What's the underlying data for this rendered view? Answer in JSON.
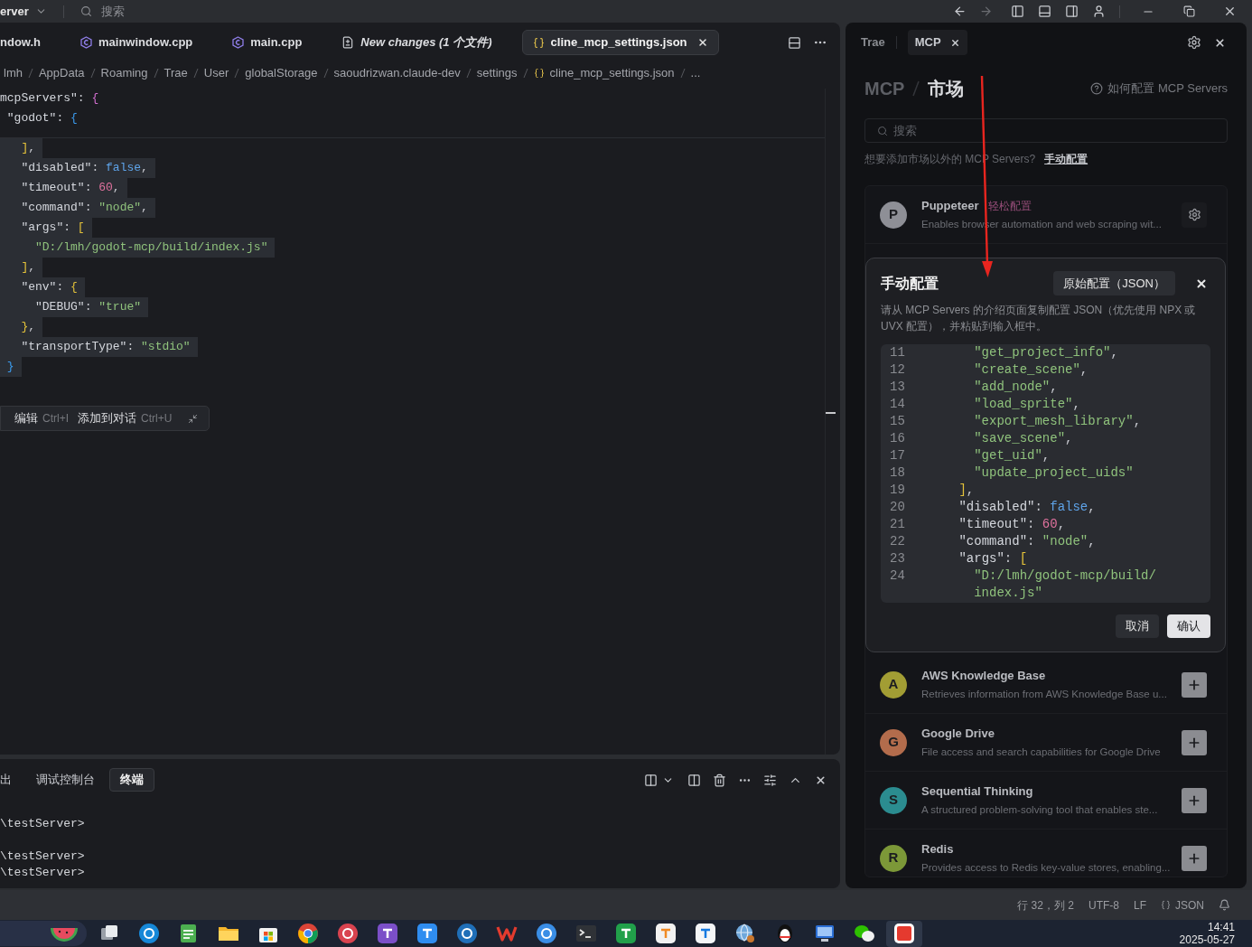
{
  "title_bar": {
    "project": "erver",
    "search": {
      "placeholder": "搜索"
    }
  },
  "editor": {
    "tabs": [
      {
        "label": "ndow.h",
        "kind": "plain",
        "selected": false
      },
      {
        "label": "mainwindow.cpp",
        "kind": "cpp",
        "selected": false
      },
      {
        "label": "main.cpp",
        "kind": "cpp",
        "selected": false
      },
      {
        "label": "New changes (1 个文件)",
        "kind": "diff",
        "selected": false
      },
      {
        "label": "cline_mcp_settings.json",
        "kind": "json",
        "selected": true
      }
    ],
    "breadcrumb": [
      {
        "label": "lmh",
        "kind": "folder"
      },
      {
        "label": "AppData",
        "kind": "folder"
      },
      {
        "label": "Roaming",
        "kind": "folder"
      },
      {
        "label": "Trae",
        "kind": "folder"
      },
      {
        "label": "User",
        "kind": "folder"
      },
      {
        "label": "globalStorage",
        "kind": "folder"
      },
      {
        "label": "saoudrizwan.claude-dev",
        "kind": "folder"
      },
      {
        "label": "settings",
        "kind": "folder"
      },
      {
        "label": "cline_mcp_settings.json",
        "kind": "file"
      },
      {
        "label": "...",
        "kind": "more"
      }
    ],
    "sticky_lines": [
      {
        "tokens": [
          {
            "kind": "key",
            "text": "mcpServers\""
          },
          {
            "kind": "punct",
            "text": ": "
          },
          {
            "kind": "brace1",
            "text": "{"
          }
        ]
      },
      {
        "tokens": [
          {
            "kind": "key",
            "text": " \"godot\""
          },
          {
            "kind": "punct",
            "text": ": "
          },
          {
            "kind": "brace2",
            "text": "{"
          }
        ]
      }
    ],
    "lines": [
      {
        "tokens": [
          {
            "kind": "brace3",
            "text": "   ]"
          },
          {
            "kind": "punct",
            "text": ","
          }
        ]
      },
      {
        "tokens": [
          {
            "kind": "key",
            "text": "   \"disabled\""
          },
          {
            "kind": "punct",
            "text": ": "
          },
          {
            "kind": "bool",
            "text": "false"
          },
          {
            "kind": "punct",
            "text": ","
          }
        ]
      },
      {
        "tokens": [
          {
            "kind": "key",
            "text": "   \"timeout\""
          },
          {
            "kind": "punct",
            "text": ": "
          },
          {
            "kind": "num",
            "text": "60"
          },
          {
            "kind": "punct",
            "text": ","
          }
        ]
      },
      {
        "tokens": [
          {
            "kind": "key",
            "text": "   \"command\""
          },
          {
            "kind": "punct",
            "text": ": "
          },
          {
            "kind": "str",
            "text": "\"node\""
          },
          {
            "kind": "punct",
            "text": ","
          }
        ]
      },
      {
        "tokens": [
          {
            "kind": "key",
            "text": "   \"args\""
          },
          {
            "kind": "punct",
            "text": ": "
          },
          {
            "kind": "brace3",
            "text": "["
          }
        ]
      },
      {
        "tokens": [
          {
            "kind": "str",
            "text": "     \"D:/lmh/godot-mcp/build/index.js\""
          }
        ]
      },
      {
        "tokens": [
          {
            "kind": "brace3",
            "text": "   ]"
          },
          {
            "kind": "punct",
            "text": ","
          }
        ]
      },
      {
        "tokens": [
          {
            "kind": "key",
            "text": "   \"env\""
          },
          {
            "kind": "punct",
            "text": ": "
          },
          {
            "kind": "brace3",
            "text": "{"
          }
        ]
      },
      {
        "tokens": [
          {
            "kind": "key",
            "text": "     \"DEBUG\""
          },
          {
            "kind": "punct",
            "text": ": "
          },
          {
            "kind": "str",
            "text": "\"true\""
          }
        ]
      },
      {
        "tokens": [
          {
            "kind": "brace3",
            "text": "   }"
          },
          {
            "kind": "punct",
            "text": ","
          }
        ]
      },
      {
        "tokens": [
          {
            "kind": "key",
            "text": "   \"transportType\""
          },
          {
            "kind": "punct",
            "text": ": "
          },
          {
            "kind": "str",
            "text": "\"stdio\""
          }
        ]
      },
      {
        "tokens": [
          {
            "kind": "brace2",
            "text": " }"
          }
        ]
      }
    ],
    "inline_actions": [
      {
        "label": "编辑",
        "shortcut": "Ctrl+I"
      },
      {
        "label": "添加到对话",
        "shortcut": "Ctrl+U"
      }
    ]
  },
  "panel": {
    "tabs": [
      {
        "label": "出",
        "selected": false
      },
      {
        "label": "调试控制台",
        "selected": false
      },
      {
        "label": "终端",
        "selected": true
      }
    ],
    "terminal_blocks": [
      [
        "\\testServer>"
      ],
      [
        "\\testServer>",
        "\\testServer>"
      ]
    ]
  },
  "sidebar": {
    "tabs": [
      {
        "label": "Trae",
        "selected": false
      },
      {
        "label": "MCP",
        "selected": true
      }
    ],
    "heading": {
      "root": "MCP",
      "current": "市场"
    },
    "help_link": "如何配置 MCP Servers",
    "search": {
      "placeholder": "搜索"
    },
    "hint": "想要添加市场以外的 MCP Servers?",
    "hint_link": "手动配置",
    "servers": [
      {
        "avatar": "P",
        "color": "#8e8f96",
        "name": "Puppeteer",
        "tag": "轻松配置",
        "description": "Enables browser automation and web scraping wit...",
        "kind": "configured"
      },
      {
        "avatar": "A",
        "color": "#a29d34",
        "name": "AWS Knowledge Base",
        "description": "Retrieves information from AWS Knowledge Base u...",
        "kind": "available"
      },
      {
        "avatar": "G",
        "color": "#b36c4c",
        "name": "Google Drive",
        "description": "File access and search capabilities for Google Drive",
        "kind": "available"
      },
      {
        "avatar": "S",
        "color": "#2b8c90",
        "name": "Sequential Thinking",
        "description": "A structured problem-solving tool that enables ste...",
        "kind": "available"
      },
      {
        "avatar": "R",
        "color": "#7c9838",
        "name": "Redis",
        "description": "Provides access to Redis key-value stores, enabling...",
        "kind": "available"
      }
    ],
    "dialog": {
      "title": "手动配置",
      "mode_button": "原始配置（JSON）",
      "description": "请从 MCP Servers 的介绍页面复制配置 JSON（优先使用 NPX 或 UVX 配置），并粘贴到输入框中。",
      "code": [
        {
          "number": "11",
          "tokens": [
            {
              "kind": "str",
              "text": "        \"get_project_info\""
            },
            {
              "kind": "punct",
              "text": ","
            }
          ]
        },
        {
          "number": "12",
          "tokens": [
            {
              "kind": "str",
              "text": "        \"create_scene\""
            },
            {
              "kind": "punct",
              "text": ","
            }
          ]
        },
        {
          "number": "13",
          "tokens": [
            {
              "kind": "str",
              "text": "        \"add_node\""
            },
            {
              "kind": "punct",
              "text": ","
            }
          ]
        },
        {
          "number": "14",
          "tokens": [
            {
              "kind": "str",
              "text": "        \"load_sprite\""
            },
            {
              "kind": "punct",
              "text": ","
            }
          ]
        },
        {
          "number": "15",
          "tokens": [
            {
              "kind": "str",
              "text": "        \"export_mesh_library\""
            },
            {
              "kind": "punct",
              "text": ","
            }
          ]
        },
        {
          "number": "16",
          "tokens": [
            {
              "kind": "str",
              "text": "        \"save_scene\""
            },
            {
              "kind": "punct",
              "text": ","
            }
          ]
        },
        {
          "number": "17",
          "tokens": [
            {
              "kind": "str",
              "text": "        \"get_uid\""
            },
            {
              "kind": "punct",
              "text": ","
            }
          ]
        },
        {
          "number": "18",
          "tokens": [
            {
              "kind": "str",
              "text": "        \"update_project_uids\""
            }
          ]
        },
        {
          "number": "19",
          "tokens": [
            {
              "kind": "brace3",
              "text": "      ]"
            },
            {
              "kind": "punct",
              "text": ","
            }
          ]
        },
        {
          "number": "20",
          "tokens": [
            {
              "kind": "key",
              "text": "      \"disabled\""
            },
            {
              "kind": "punct",
              "text": ": "
            },
            {
              "kind": "bool",
              "text": "false"
            },
            {
              "kind": "punct",
              "text": ","
            }
          ]
        },
        {
          "number": "21",
          "tokens": [
            {
              "kind": "key",
              "text": "      \"timeout\""
            },
            {
              "kind": "punct",
              "text": ": "
            },
            {
              "kind": "num",
              "text": "60"
            },
            {
              "kind": "punct",
              "text": ","
            }
          ]
        },
        {
          "number": "22",
          "tokens": [
            {
              "kind": "key",
              "text": "      \"command\""
            },
            {
              "kind": "punct",
              "text": ": "
            },
            {
              "kind": "str",
              "text": "\"node\""
            },
            {
              "kind": "punct",
              "text": ","
            }
          ]
        },
        {
          "number": "23",
          "tokens": [
            {
              "kind": "key",
              "text": "      \"args\""
            },
            {
              "kind": "punct",
              "text": ": "
            },
            {
              "kind": "brace3",
              "text": "["
            }
          ]
        },
        {
          "number": "24",
          "tokens": [
            {
              "kind": "str",
              "text": "        \"D:/lmh/godot-mcp/build/index.js\""
            }
          ]
        }
      ],
      "buttons": [
        {
          "label": "取消",
          "kind": "secondary"
        },
        {
          "label": "确认",
          "kind": "primary"
        }
      ]
    }
  },
  "status_bar": [
    {
      "kind": "text",
      "text": "行 32，列 2"
    },
    {
      "kind": "text",
      "text": "UTF-8"
    },
    {
      "kind": "text",
      "text": "LF"
    },
    {
      "kind": "language",
      "text": "JSON"
    }
  ],
  "taskbar": {
    "time": "14:41",
    "date": "2025-05-27"
  }
}
